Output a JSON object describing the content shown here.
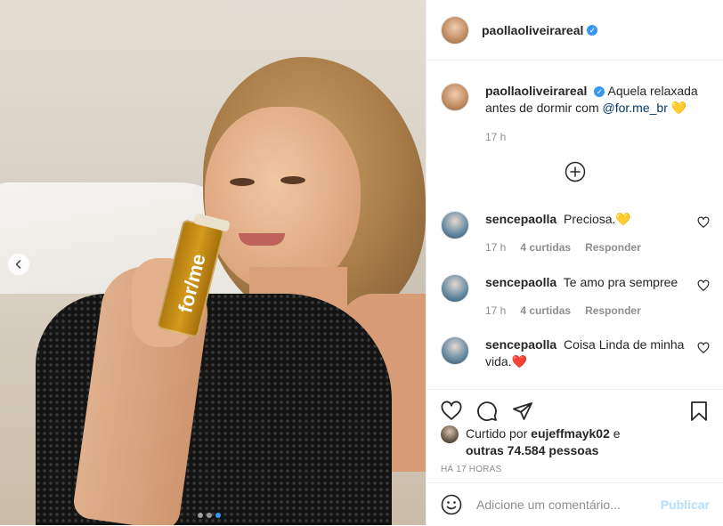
{
  "post": {
    "carousel": {
      "dots": 3,
      "active_index": 2
    },
    "photo_text": "for/me"
  },
  "header": {
    "username": "paollaoliveirareal",
    "verified": true
  },
  "caption": {
    "username": "paollaoliveirareal",
    "text_before": "Aquela relaxada antes de dormir com ",
    "mention": "@for.me_br",
    "emoji": "💛",
    "time": "17 h"
  },
  "comments": [
    {
      "username": "sencepaolla",
      "text": "Preciosa.",
      "emoji": "💛",
      "time": "17 h",
      "likes": "4 curtidas",
      "reply": "Responder"
    },
    {
      "username": "sencepaolla",
      "text": "Te amo pra sempree",
      "emoji": "",
      "time": "17 h",
      "likes": "4 curtidas",
      "reply": "Responder"
    },
    {
      "username": "sencepaolla",
      "text": "Coisa Linda de minha vida.",
      "emoji": "❤️",
      "time": "",
      "likes": "",
      "reply": ""
    }
  ],
  "likes": {
    "prefix": "Curtido por",
    "first_user": "eujeffmayk02",
    "conjunction": "e",
    "others": "outras 74.584 pessoas"
  },
  "timestamp": "HÁ 17 HORAS",
  "add_comment": {
    "placeholder": "Adicione um comentário...",
    "publish_label": "Publicar"
  },
  "colors": {
    "accent": "#3897f0",
    "text": "#262626",
    "muted": "#8e8e8e",
    "publish_disabled": "#b2dffc",
    "mention": "#00376b"
  },
  "icons": {
    "carousel_prev": "chevron-left-icon",
    "load_more": "plus-circle-icon",
    "like": "heart-icon",
    "comment": "comment-icon",
    "share": "paper-plane-icon",
    "save": "bookmark-icon",
    "emoji": "smiley-icon"
  }
}
